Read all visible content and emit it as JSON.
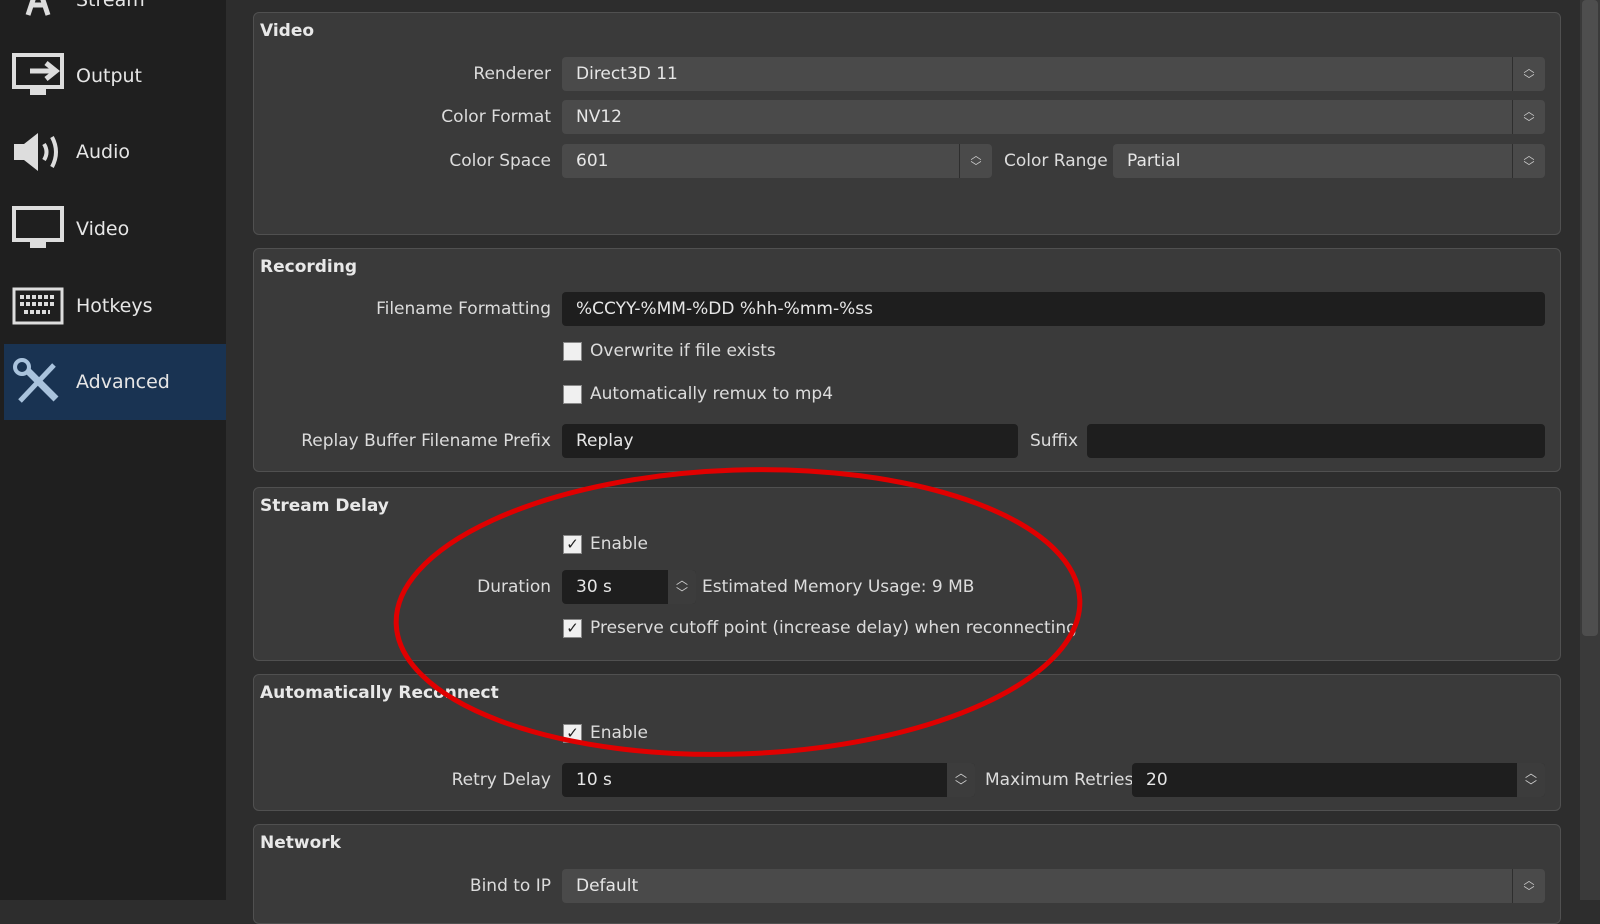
{
  "sidebar": {
    "items": [
      {
        "label": "Stream",
        "icon": "stream-icon"
      },
      {
        "label": "Output",
        "icon": "output-icon"
      },
      {
        "label": "Audio",
        "icon": "speaker-icon"
      },
      {
        "label": "Video",
        "icon": "monitor-icon"
      },
      {
        "label": "Hotkeys",
        "icon": "keyboard-icon"
      },
      {
        "label": "Advanced",
        "icon": "tools-icon",
        "selected": true
      }
    ]
  },
  "video": {
    "title": "Video",
    "renderer_label": "Renderer",
    "renderer": "Direct3D 11",
    "color_format_label": "Color Format",
    "color_format": "NV12",
    "color_space_label": "Color Space",
    "color_space": "601",
    "color_range_label": "Color Range",
    "color_range": "Partial"
  },
  "recording": {
    "title": "Recording",
    "filename_label": "Filename Formatting",
    "filename": "%CCYY-%MM-%DD %hh-%mm-%ss",
    "overwrite_label": "Overwrite if file exists",
    "overwrite": false,
    "remux_label": "Automatically remux to mp4",
    "remux": false,
    "prefix_label": "Replay Buffer Filename Prefix",
    "prefix": "Replay",
    "suffix_label": "Suffix",
    "suffix": ""
  },
  "stream_delay": {
    "title": "Stream Delay",
    "enable_label": "Enable",
    "enable": true,
    "duration_label": "Duration",
    "duration": "30 s",
    "memory": "Estimated Memory Usage: 9 MB",
    "preserve_label": "Preserve cutoff point (increase delay) when reconnecting",
    "preserve": true
  },
  "reconnect": {
    "title": "Automatically Reconnect",
    "enable_label": "Enable",
    "enable": true,
    "retry_delay_label": "Retry Delay",
    "retry_delay": "10 s",
    "max_retries_label": "Maximum Retries",
    "max_retries": "20"
  },
  "network": {
    "title": "Network",
    "bind_label": "Bind to IP",
    "bind": "Default"
  },
  "colors": {
    "annotation": "#e00000",
    "selected": "#193352"
  }
}
